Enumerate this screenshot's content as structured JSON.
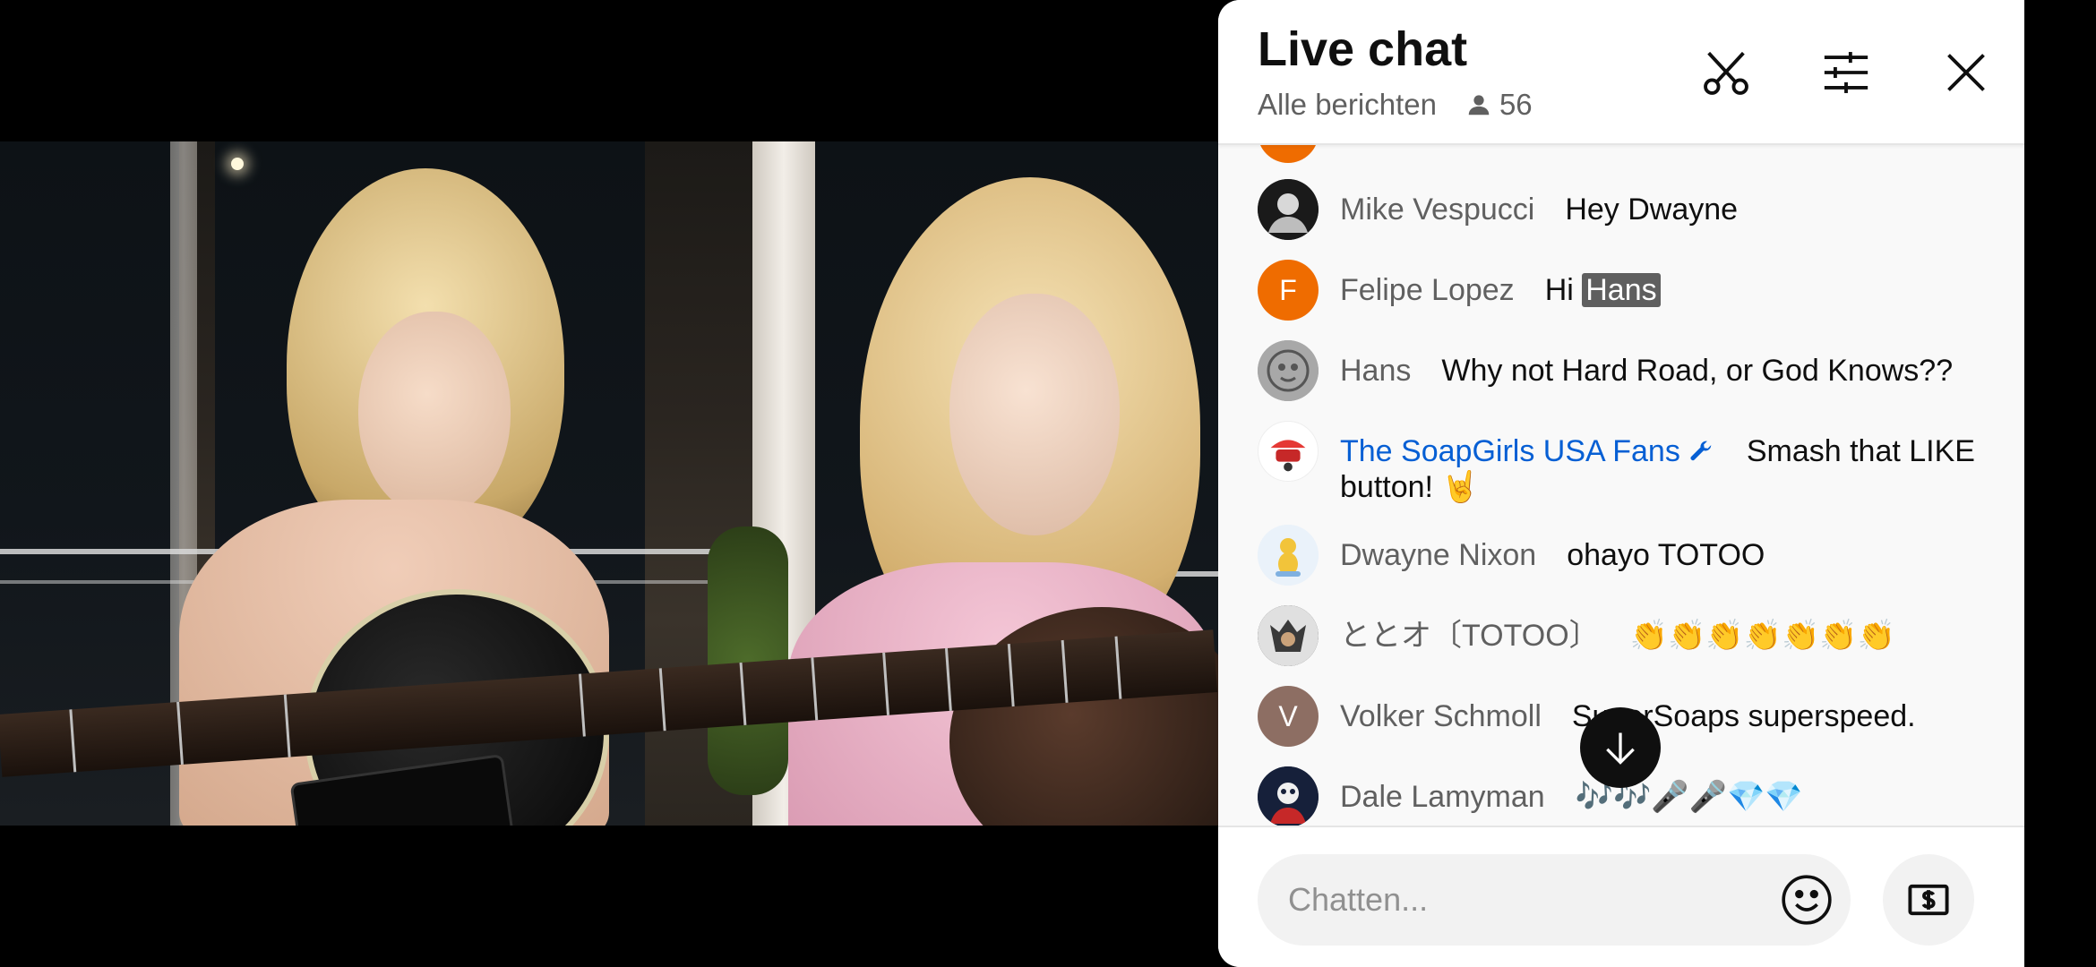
{
  "chat": {
    "title": "Live chat",
    "filter_label": "Alle berichten",
    "viewer_count": "56",
    "input_placeholder": "Chatten...",
    "icons": {
      "clip": "scissors-icon",
      "settings": "sliders-icon",
      "close": "close-icon",
      "emoji": "smiley-icon",
      "super_chat": "dollar-bill-icon",
      "scroll": "arrow-down-icon",
      "viewers": "person-icon"
    },
    "messages": [
      {
        "author": "Mike Vespucci",
        "text": "Hey Dwayne",
        "avatar_letter": "",
        "avatar_color": "#2b2b2b"
      },
      {
        "author": "Felipe Lopez",
        "text_prefix": "Hi",
        "mention": "Hans",
        "avatar_letter": "F",
        "avatar_color": "#ef6c00"
      },
      {
        "author": "Hans",
        "text": "Why not Hard Road, or God Knows??",
        "avatar_letter": "",
        "avatar_color": "#8a8a8a"
      },
      {
        "author": "The SoapGirls USA Fans",
        "text": "Smash that LIKE button! 🤘",
        "owner_badge": "wrench-icon",
        "avatar_letter": "",
        "avatar_color": "#ffffff"
      },
      {
        "author": "Dwayne Nixon",
        "text": "ohayo TOTOO",
        "avatar_letter": "",
        "avatar_color": "#e8f0f8"
      },
      {
        "author": "ととオ〔TOTOO〕",
        "text": "👏👏👏👏👏👏👏",
        "avatar_letter": "",
        "avatar_color": "#555555"
      },
      {
        "author": "Volker Schmoll",
        "text": "SuperSoaps superspeed.",
        "avatar_letter": "V",
        "avatar_color": "#8d6e63"
      },
      {
        "author": "Dale Lamyman",
        "text": "🎶🎶🎤🎤💎💎",
        "avatar_letter": "",
        "avatar_color": "#1a2238"
      }
    ]
  },
  "colors": {
    "owner_name": "#065fd4",
    "author_name": "#606060",
    "mention_bg": "#5f5f5f"
  }
}
